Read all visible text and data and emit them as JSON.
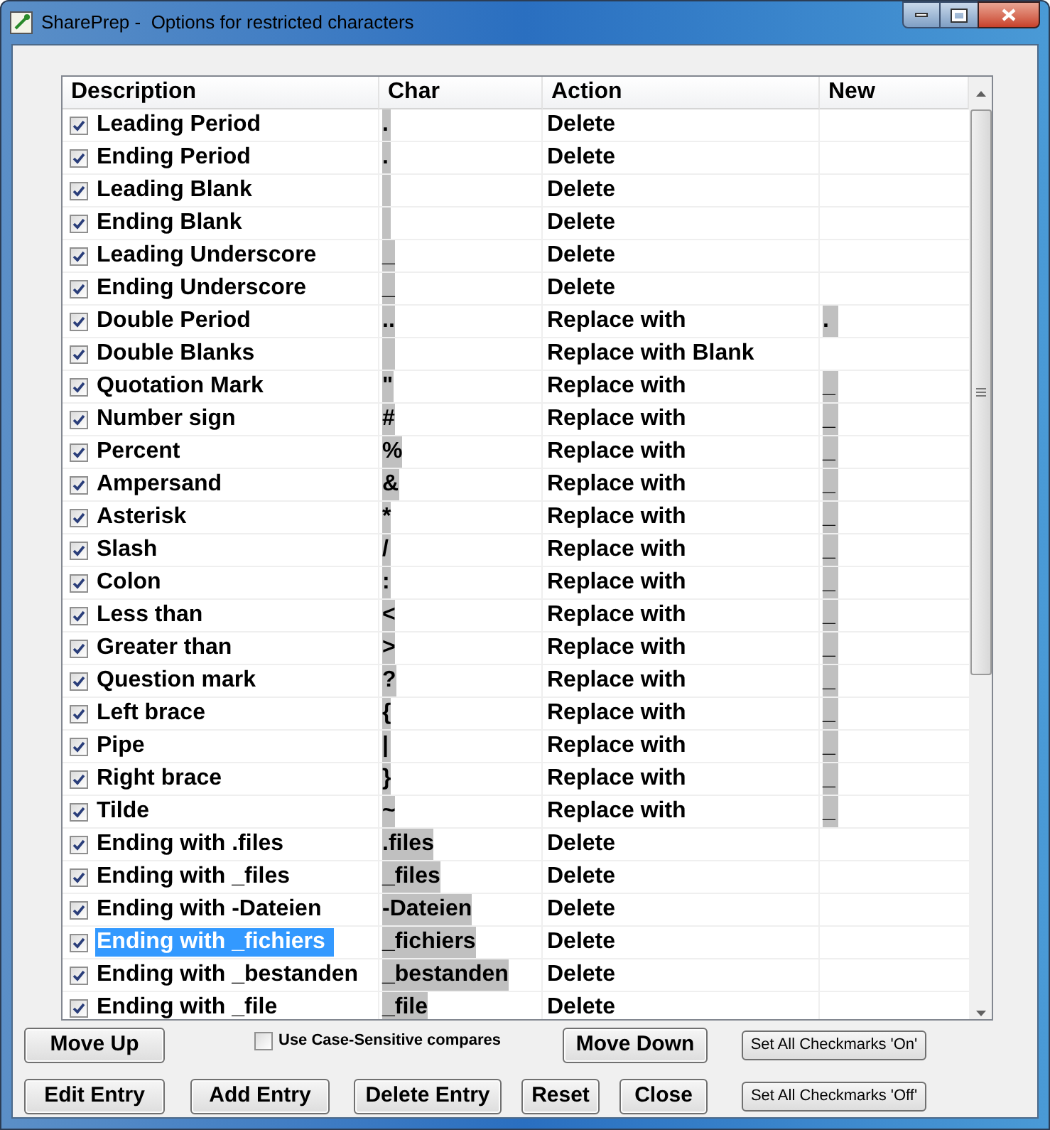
{
  "window": {
    "title": "SharePrep -  Options for restricted characters"
  },
  "table": {
    "columns": [
      "Description",
      "Char",
      "Action",
      "New"
    ],
    "rows": [
      {
        "checked": true,
        "selected": false,
        "description": "Leading Period",
        "char": ".",
        "action": "Delete"
      },
      {
        "checked": true,
        "selected": false,
        "description": "Ending Period",
        "char": ".",
        "action": "Delete"
      },
      {
        "checked": true,
        "selected": false,
        "description": "Leading Blank",
        "char": " ",
        "action": "Delete"
      },
      {
        "checked": true,
        "selected": false,
        "description": "Ending Blank",
        "char": " ",
        "action": "Delete"
      },
      {
        "checked": true,
        "selected": false,
        "description": "Leading Underscore",
        "char": "_",
        "action": "Delete"
      },
      {
        "checked": true,
        "selected": false,
        "description": "Ending Underscore",
        "char": "_",
        "action": "Delete"
      },
      {
        "checked": true,
        "selected": false,
        "description": "Double Period",
        "char": "..",
        "action": "Replace with",
        "new": "."
      },
      {
        "checked": true,
        "selected": false,
        "description": "Double Blanks",
        "char": "  ",
        "action": "Replace with Blank"
      },
      {
        "checked": true,
        "selected": false,
        "description": "Quotation Mark",
        "char": "\"",
        "action": "Replace with",
        "new": "_"
      },
      {
        "checked": true,
        "selected": false,
        "description": "Number sign",
        "char": "#",
        "action": "Replace with",
        "new": "_"
      },
      {
        "checked": true,
        "selected": false,
        "description": "Percent",
        "char": "%",
        "action": "Replace with",
        "new": "_"
      },
      {
        "checked": true,
        "selected": false,
        "description": "Ampersand",
        "char": "&",
        "action": "Replace with",
        "new": "_"
      },
      {
        "checked": true,
        "selected": false,
        "description": "Asterisk",
        "char": "*",
        "action": "Replace with",
        "new": "_"
      },
      {
        "checked": true,
        "selected": false,
        "description": "Slash",
        "char": "/",
        "action": "Replace with",
        "new": "_"
      },
      {
        "checked": true,
        "selected": false,
        "description": "Colon",
        "char": ":",
        "action": "Replace with",
        "new": "_"
      },
      {
        "checked": true,
        "selected": false,
        "description": "Less than",
        "char": "<",
        "action": "Replace with",
        "new": "_"
      },
      {
        "checked": true,
        "selected": false,
        "description": "Greater than",
        "char": ">",
        "action": "Replace with",
        "new": "_"
      },
      {
        "checked": true,
        "selected": false,
        "description": "Question mark",
        "char": "?",
        "action": "Replace with",
        "new": "_"
      },
      {
        "checked": true,
        "selected": false,
        "description": "Left brace",
        "char": "{",
        "action": "Replace with",
        "new": "_"
      },
      {
        "checked": true,
        "selected": false,
        "description": "Pipe",
        "char": "|",
        "action": "Replace with",
        "new": "_"
      },
      {
        "checked": true,
        "selected": false,
        "description": "Right brace",
        "char": "}",
        "action": "Replace with",
        "new": "_"
      },
      {
        "checked": true,
        "selected": false,
        "description": "Tilde",
        "char": "~",
        "action": "Replace with",
        "new": "_"
      },
      {
        "checked": true,
        "selected": false,
        "description": "Ending with .files",
        "char": ".files",
        "action": "Delete"
      },
      {
        "checked": true,
        "selected": false,
        "description": "Ending with _files",
        "char": "_files",
        "action": "Delete"
      },
      {
        "checked": true,
        "selected": false,
        "description": "Ending with -Dateien",
        "char": "-Dateien",
        "action": "Delete"
      },
      {
        "checked": true,
        "selected": true,
        "description": "Ending with _fichiers",
        "char": "_fichiers",
        "action": "Delete"
      },
      {
        "checked": true,
        "selected": false,
        "description": "Ending with _bestanden",
        "char": "_bestanden",
        "action": "Delete"
      },
      {
        "checked": true,
        "selected": false,
        "description": "Ending with _file",
        "char": "_file",
        "action": "Delete"
      }
    ]
  },
  "move_up": "Move Up",
  "case_sensitive": {
    "label": "Use Case-Sensitive compares",
    "checked": false
  },
  "move_down": "Move Down",
  "set_all_on": "Set All Checkmarks 'On'",
  "buttons": [
    "Edit Entry",
    "Add Entry",
    "Delete Entry",
    "Reset",
    "Close"
  ],
  "set_all_off": "Set All Checkmarks 'Off'"
}
